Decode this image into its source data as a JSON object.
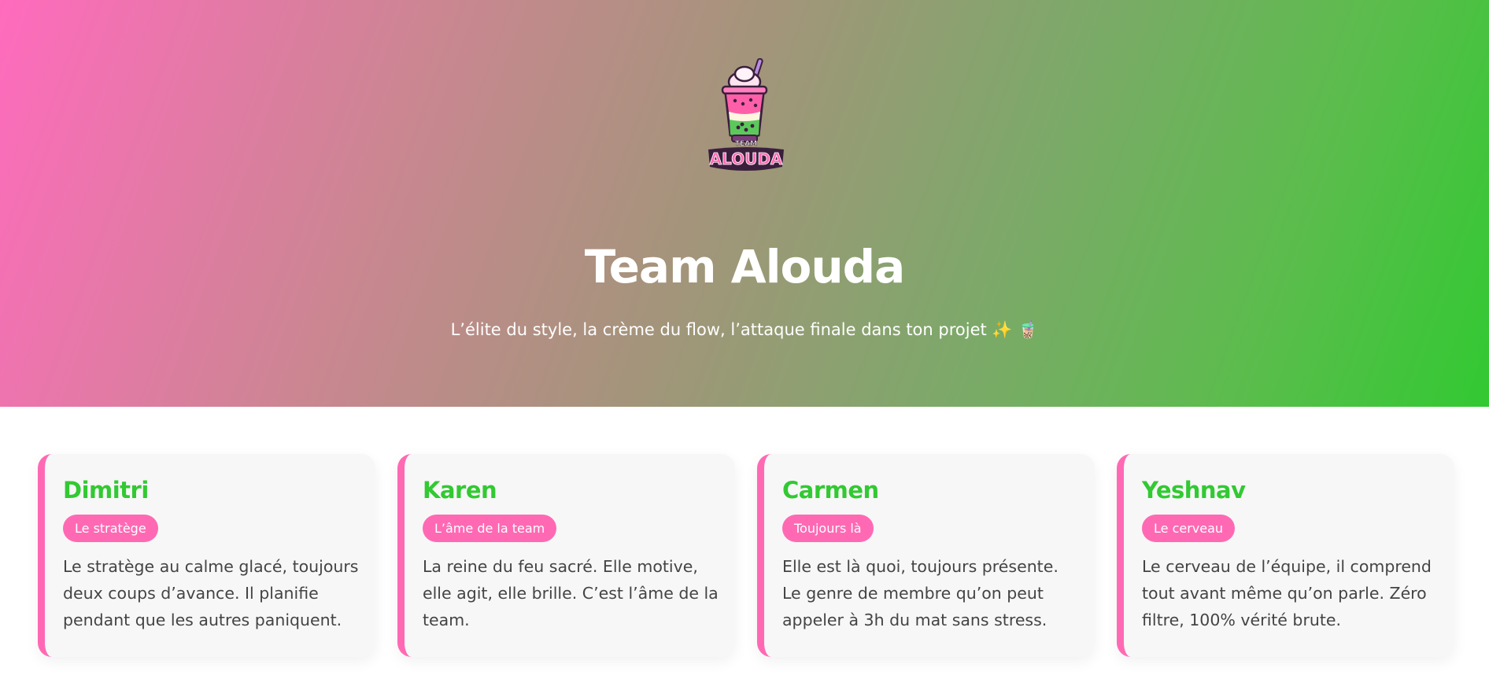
{
  "hero": {
    "logo_text_top": "TEAM",
    "logo_text_bottom": "ALOUDA",
    "title": "Team Alouda",
    "subtitle": "L’élite du style, la crème du flow, l’attaque finale dans ton projet ✨ 🧋"
  },
  "members": [
    {
      "name": "Dimitri",
      "role": "Le stratège",
      "description": "Le stratège au calme glacé, toujours deux coups d’avance. Il planifie pendant que les autres paniquent."
    },
    {
      "name": "Karen",
      "role": "L’âme de la team",
      "description": "La reine du feu sacré. Elle motive, elle agit, elle brille. C’est l’âme de la team."
    },
    {
      "name": "Carmen",
      "role": "Toujours là",
      "description": "Elle est là quoi, toujours présente. Le genre de membre qu’on peut appeler à 3h du mat sans stress."
    },
    {
      "name": "Yeshnav",
      "role": "Le cerveau",
      "description": "Le cerveau de l’équipe, il comprend tout avant même qu’on parle. Zéro filtre, 100% vérité brute."
    }
  ],
  "colors": {
    "accent_pink": "#ff69b4",
    "accent_green": "#32c932",
    "card_bg": "#f7f7f7",
    "text": "#444444"
  },
  "icons": {
    "logo": "bubble-tea-cup-logo"
  }
}
